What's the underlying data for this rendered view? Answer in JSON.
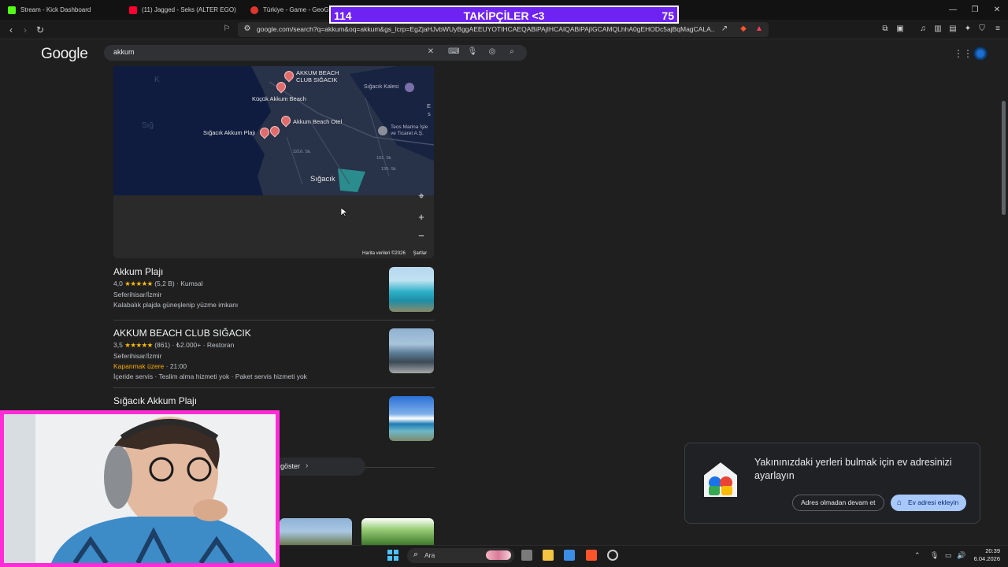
{
  "browser": {
    "tabs": [
      {
        "title": "Stream - Kick Dashboard",
        "favicon_color": "#53fc18"
      },
      {
        "title": "(11) Jagged - Seks (ALTER EGO)",
        "favicon_color": "#ff0033"
      },
      {
        "title": "Türkiye - Game - GeoGue",
        "favicon_color": "#e0362e"
      }
    ],
    "url": "google.com/search?q=akkum&oq=akkum&gs_lcrp=EgZjaHJvbWUyBggAEEUYOTIHCAEQABiPAjIHCAIQABiPAjIGCAMQLhhA0gEHODc5ajBqMagCALA..."
  },
  "overlay": {
    "left": "114",
    "center": "TAKİPÇİLER <3",
    "right": "75"
  },
  "google": {
    "logo": "Google",
    "query": "akkum"
  },
  "map": {
    "labels": {
      "club": "AKKUM BEACH\nCLUB SIĞACIK",
      "kucuk": "Küçük Akkum Beach",
      "otel": "Akkum Beach Otel",
      "plaji": "Sığacık Akkum Plajı",
      "town": "Sığacık",
      "kalesi": "Sığacık Kalesi",
      "teos": "Teos Marina İşle\nve Ticaret A.Ş.",
      "k": "K",
      "sig": "Sığ",
      "e": "E",
      "s": "s",
      "road1": "3216. Sk.",
      "road2": "161. Sk",
      "road3": "139. Sk"
    },
    "footer_data": "Harita verileri ©2026",
    "footer_terms": "Şartlar"
  },
  "results": [
    {
      "title": "Akkum Plajı",
      "rating": "4,0",
      "stars": "★★★★★",
      "reviews": "(5,2 B)",
      "category": "Kumsal",
      "location": "Seferihisar/İzmir",
      "desc": "Kalabalık plajda güneşlenip yüzme imkanı"
    },
    {
      "title": "AKKUM BEACH CLUB SIĞACIK",
      "rating": "3,5",
      "stars": "★★★★★",
      "reviews": "(861)",
      "price": "₺2.000+",
      "category": "Restoran",
      "location": "Seferihisar/İzmir",
      "status": "Kapanmak üzere",
      "status_time": "· 21:00",
      "services": "İçeride servis · Teslim alma hizmeti yok · Paket servis hizmeti yok"
    },
    {
      "title": "Sığacık Akkum Plajı"
    }
  ],
  "more": {
    "label": "göster"
  },
  "popup": {
    "message": "Yakınınızdaki yerleri bulmak için ev adresinizi ayarlayın",
    "button_secondary": "Adres olmadan devam et",
    "button_primary": "Ev adresi ekleyin"
  },
  "taskbar": {
    "search_placeholder": "Ara",
    "time": "20:39",
    "date": "6.04.2026"
  },
  "colors": {
    "overlay_bg": "#6f23f2",
    "cam_border": "#ff2bd6",
    "link_status": "#f9ab00",
    "primary_button": "#a8c7fa"
  }
}
